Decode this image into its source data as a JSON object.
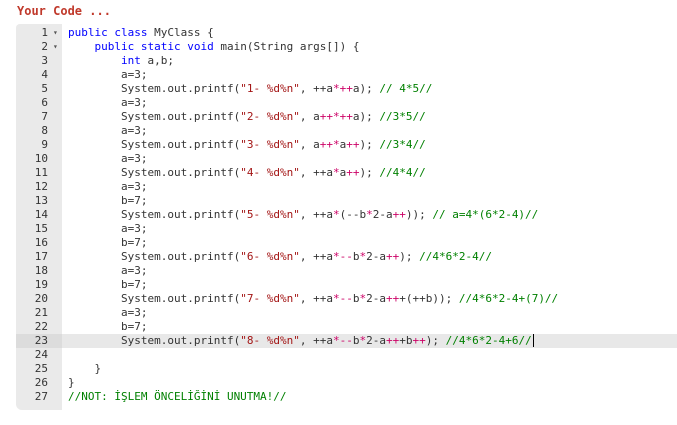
{
  "header": {
    "title": "Your Code ..."
  },
  "editor": {
    "active_line": 23,
    "lines": [
      {
        "n": "1",
        "fold": "▾",
        "code": "public class MyClass {"
      },
      {
        "n": "2",
        "fold": "▾",
        "code": "    public static void main(String args[]) {"
      },
      {
        "n": "3",
        "fold": "",
        "code": "        int a,b;"
      },
      {
        "n": "4",
        "fold": "",
        "code": "        a=3;"
      },
      {
        "n": "5",
        "fold": "",
        "code": "        System.out.printf(\"1- %d%n\", ++a*++a); // 4*5//"
      },
      {
        "n": "6",
        "fold": "",
        "code": "        a=3;"
      },
      {
        "n": "7",
        "fold": "",
        "code": "        System.out.printf(\"2- %d%n\", a++*++a); //3*5//"
      },
      {
        "n": "8",
        "fold": "",
        "code": "        a=3;"
      },
      {
        "n": "9",
        "fold": "",
        "code": "        System.out.printf(\"3- %d%n\", a++*a++); //3*4//"
      },
      {
        "n": "10",
        "fold": "",
        "code": "        a=3;"
      },
      {
        "n": "11",
        "fold": "",
        "code": "        System.out.printf(\"4- %d%n\", ++a*a++); //4*4//"
      },
      {
        "n": "12",
        "fold": "",
        "code": "        a=3;"
      },
      {
        "n": "13",
        "fold": "",
        "code": "        b=7;"
      },
      {
        "n": "14",
        "fold": "",
        "code": "        System.out.printf(\"5- %d%n\", ++a*(--b*2-a++)); // a=4*(6*2-4)//"
      },
      {
        "n": "15",
        "fold": "",
        "code": "        a=3;"
      },
      {
        "n": "16",
        "fold": "",
        "code": "        b=7;"
      },
      {
        "n": "17",
        "fold": "",
        "code": "        System.out.printf(\"6- %d%n\", ++a*--b*2-a++); //4*6*2-4//"
      },
      {
        "n": "18",
        "fold": "",
        "code": "        a=3;"
      },
      {
        "n": "19",
        "fold": "",
        "code": "        b=7;"
      },
      {
        "n": "20",
        "fold": "",
        "code": "        System.out.printf(\"7- %d%n\", ++a*--b*2-a+++(++b)); //4*6*2-4+(7)//"
      },
      {
        "n": "21",
        "fold": "",
        "code": "        a=3;"
      },
      {
        "n": "22",
        "fold": "",
        "code": "        b=7;"
      },
      {
        "n": "23",
        "fold": "",
        "code": "        System.out.printf(\"8- %d%n\", ++a*--b*2-a+++b++); //4*6*2-4+6//"
      },
      {
        "n": "24",
        "fold": "",
        "code": ""
      },
      {
        "n": "25",
        "fold": "",
        "code": "    }"
      },
      {
        "n": "26",
        "fold": "",
        "code": "}"
      },
      {
        "n": "27",
        "fold": "",
        "code": "//NOT: İŞLEM ÖNCELİĞİNİ UNUTMA!//"
      }
    ]
  }
}
